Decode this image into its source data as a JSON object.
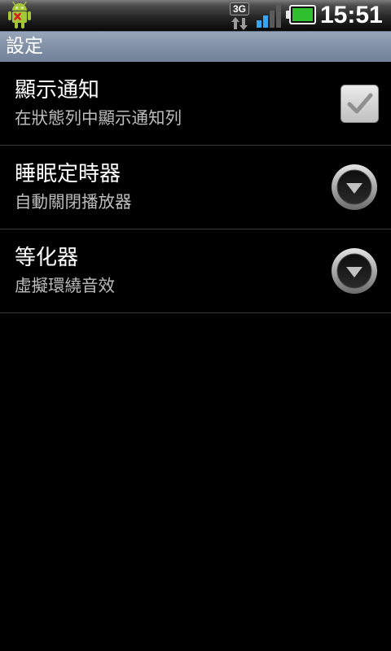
{
  "status_bar": {
    "notification_icon": "android-robot-icon",
    "network_type": "3G",
    "data_activity_icon": "up-down-arrows-icon",
    "signal_icon": "signal-bars-icon",
    "signal_level": 0.5,
    "battery_icon": "battery-icon",
    "battery_level": 1.0,
    "time": "15:51"
  },
  "title_bar": {
    "title": "設定"
  },
  "settings": [
    {
      "title": "顯示通知",
      "summary": "在狀態列中顯示通知列",
      "control_icon": "checkbox-icon",
      "checked": true
    },
    {
      "title": "睡眠定時器",
      "summary": "自動關閉播放器",
      "control_icon": "dropdown-icon"
    },
    {
      "title": "等化器",
      "summary": "虛擬環繞音效",
      "control_icon": "dropdown-icon"
    }
  ],
  "colors": {
    "background": "#000000",
    "title_bar": "#7d8da3",
    "primary_text": "#ffffff",
    "secondary_text": "#bdbdbd",
    "divider": "#3a3a3a",
    "signal_active": "#33a6f5",
    "signal_inactive": "#5a5a5a",
    "battery_fill": "#2fbf2f",
    "android_green": "#a4c639",
    "error_red": "#d92020"
  }
}
